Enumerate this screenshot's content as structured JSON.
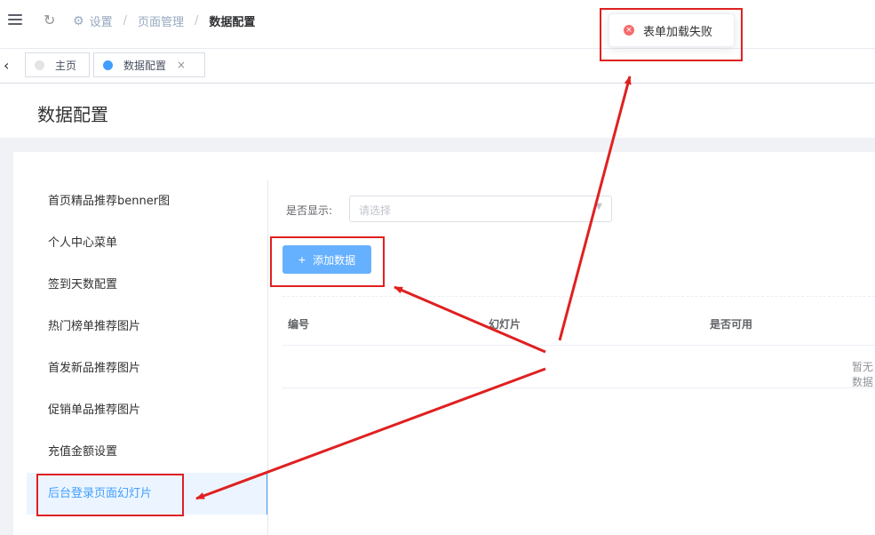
{
  "breadcrumb": {
    "items": [
      "设置",
      "页面管理",
      "数据配置"
    ],
    "separator": "/"
  },
  "tags": [
    {
      "label": "主页",
      "active": false
    },
    {
      "label": "数据配置",
      "active": true,
      "close": "×"
    }
  ],
  "page_title": "数据配置",
  "menu": [
    "首页精品推荐benner图",
    "个人中心菜单",
    "签到天数配置",
    "热门榜单推荐图片",
    "首发新品推荐图片",
    "促销单品推荐图片",
    "充值金额设置",
    "后台登录页面幻灯片"
  ],
  "filter": {
    "label": "是否显示:",
    "placeholder": "请选择"
  },
  "add_button": {
    "icon": "+",
    "label": "添加数据"
  },
  "table": {
    "headers": [
      "编号",
      "幻灯片",
      "是否可用"
    ],
    "empty_text": "暂无数据"
  },
  "toast": {
    "icon": "×",
    "message": "表单加载失败"
  },
  "colors": {
    "primary": "#409eff",
    "button": "#66b1ff",
    "error": "#f56c6c",
    "annotation": "#e02020"
  }
}
